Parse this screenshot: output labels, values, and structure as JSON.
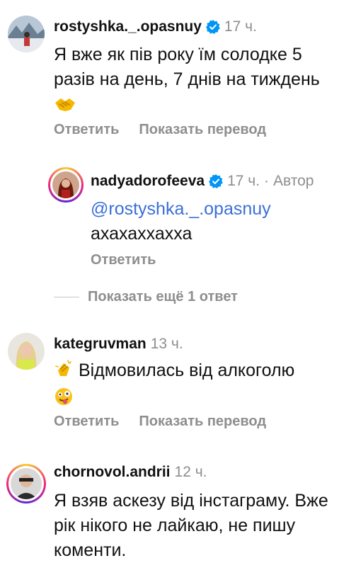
{
  "comments": [
    {
      "username": "rostyshka._.opasnuy",
      "time": "17 ч.",
      "text": "Я вже як пів року їм солодке 5 разів на день, 7 днів на тиждень",
      "emoji": "handshake-emoji",
      "reply_label": "Ответить",
      "translate_label": "Показать перевод"
    },
    {
      "username": "nadyadorofeeva",
      "time": "17 ч.",
      "separator": "·",
      "author_label": "Автор",
      "mention": "@rostyshka._.opasnuy",
      "text": "ахахаххахха",
      "reply_label": "Ответить"
    },
    {
      "username": "kategruvman",
      "time": "13 ч.",
      "text": "Відмовилась від алкоголю",
      "emoji_before": "clapping-hands-emoji",
      "emoji_after": "zany-face-emoji",
      "reply_label": "Ответить",
      "translate_label": "Показать перевод"
    },
    {
      "username": "chornovol.andrii",
      "time": "12 ч.",
      "text": "Я взяв аскезу від інстаграму. Вже рік нікого не лайкаю, не пишу коменти."
    }
  ],
  "more_replies_label": "Показать ещё 1 ответ",
  "colors": {
    "username": "#111111",
    "meta_gray": "#8e8e8e",
    "mention": "#3b6fd6",
    "verified": "#0095f6"
  }
}
